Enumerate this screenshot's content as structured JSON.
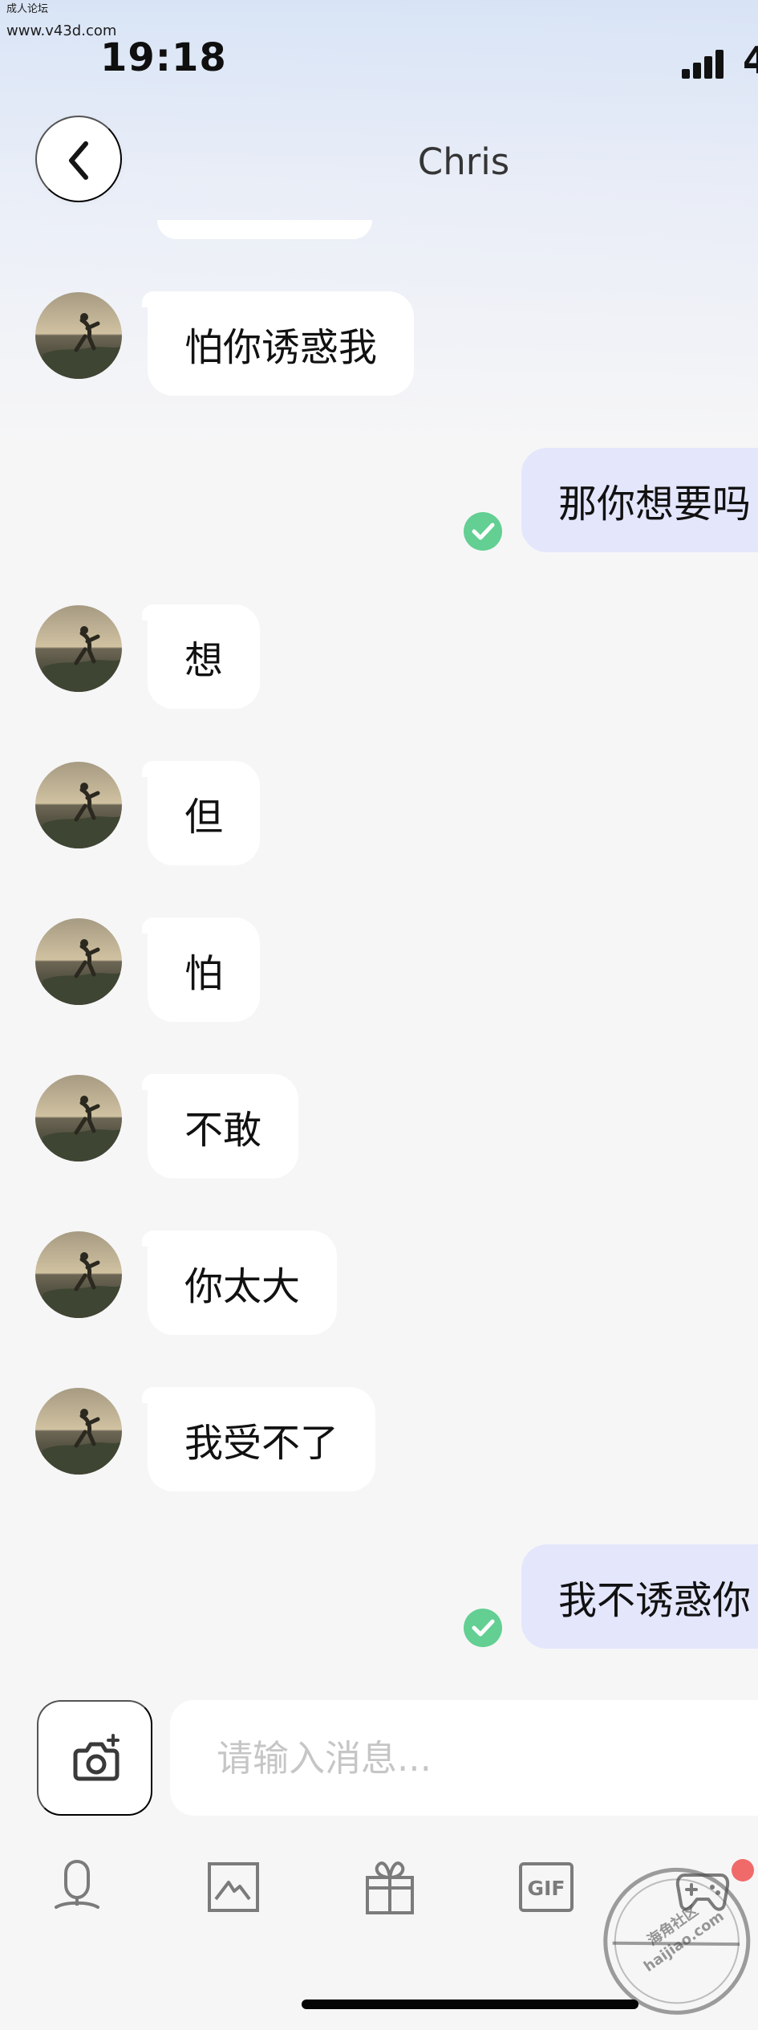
{
  "watermark": {
    "line1": "成人论坛",
    "line2": "www.v43d.com",
    "stamp_line1": "海角社区",
    "stamp_line2": "haijiao.com"
  },
  "status_bar": {
    "time": "19:18",
    "clipped_indicator": "4"
  },
  "header": {
    "contact_name": "Chris"
  },
  "messages": [
    {
      "direction": "incoming",
      "text": "怕你诱惑我"
    },
    {
      "direction": "outgoing",
      "text": "那你想要吗",
      "status": "read"
    },
    {
      "direction": "incoming",
      "text": "想"
    },
    {
      "direction": "incoming",
      "text": "但"
    },
    {
      "direction": "incoming",
      "text": "怕"
    },
    {
      "direction": "incoming",
      "text": "不敢"
    },
    {
      "direction": "incoming",
      "text": "你太大"
    },
    {
      "direction": "incoming",
      "text": "我受不了"
    },
    {
      "direction": "outgoing",
      "text": "我不诱惑你",
      "status": "read"
    }
  ],
  "composer": {
    "placeholder": "请输入消息...",
    "value": ""
  },
  "toolbar": {
    "items": [
      {
        "name": "voice",
        "icon": "microphone-icon"
      },
      {
        "name": "photo",
        "icon": "image-icon"
      },
      {
        "name": "gift",
        "icon": "gift-icon"
      },
      {
        "name": "gif",
        "icon": "gif-icon",
        "label": "GIF"
      },
      {
        "name": "game",
        "icon": "gamepad-icon"
      }
    ]
  },
  "colors": {
    "outgoing_bubble": "#e4e6fc",
    "incoming_bubble": "#ffffff",
    "read_check": "#63cf92",
    "notification_dot": "#f06a6a"
  }
}
